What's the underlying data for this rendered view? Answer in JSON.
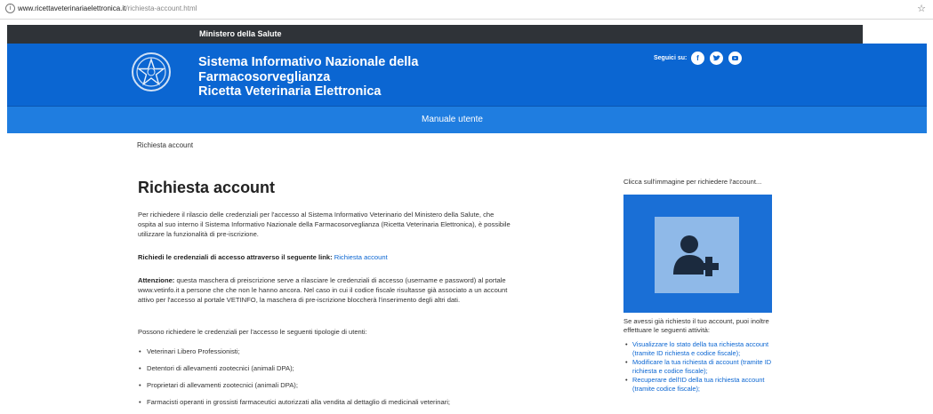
{
  "browser": {
    "url_host": "www.ricettaveterinariaelettronica.it",
    "url_path": "/richiesta-account.html"
  },
  "topbar": {
    "label": "Ministero della Salute"
  },
  "header": {
    "title_lines": [
      "Sistema Informativo Nazionale della",
      "Farmacosorveglianza",
      "Ricetta Veterinaria Elettronica"
    ],
    "social_label": "Seguici su:",
    "social_icons": [
      "facebook-icon",
      "twitter-icon",
      "youtube-icon"
    ]
  },
  "nav": {
    "manuale": "Manuale utente"
  },
  "breadcrumb": "Richiesta account",
  "main": {
    "title": "Richiesta account",
    "intro": "Per richiedere il rilascio delle credenziali per l'accesso al Sistema Informativo Veterinario del Ministero della Salute, che ospita al suo interno il Sistema Informativo Nazionale della Farmacosorveglianza (Ricetta Veterinaria Elettronica), è possibile utilizzare la funzionalità di pre-iscrizione.",
    "link_prefix": "Richiedi le credenziali di accesso attraverso il seguente link:",
    "link_text": "Richiesta account",
    "attention_label": "Attenzione:",
    "attention_text": "questa maschera di preiscrizione serve a rilasciare le credenziali di accesso (username e password) al portale www.vetinfo.it a persone che che non le hanno ancora. Nel caso in cui il codice fiscale risultasse già associato a un account attivo per l'accesso al portale VETINFO, la maschera di pre-iscrizione bloccherà l'inserimento degli altri dati.",
    "users_intro": "Possono richiedere le credenziali per l'accesso le seguenti tipologie di utenti:",
    "user_types": [
      "Veterinari Libero Professionisti;",
      "Detentori di allevamenti zootecnici (animali DPA);",
      "Proprietari di allevamenti zootecnici (animali DPA);",
      "Farmacisti operanti in grossisti farmaceutici autorizzati alla vendita al dettaglio di medicinali veterinari;"
    ]
  },
  "sidebar": {
    "click_text": "Clicca sull'immagine per richiedere l'account...",
    "icon": "add-user-icon",
    "after_text": "Se avessi già richiesto il tuo account, puoi inoltre effettuare le seguenti attività:",
    "actions": [
      "Visualizzare lo stato della tua richiesta account (tramite ID richiesta e codice fiscale);",
      "Modificare la tua richiesta di account (tramite ID richiesta e codice fiscale);",
      "Recuperare dell'ID della tua richiesta account (tramite codice fiscale);"
    ]
  },
  "colors": {
    "header_blue": "#0b66d2",
    "nav_blue": "#1f7de0",
    "topbar_dark": "#2f3338",
    "link": "#0b66d2"
  }
}
